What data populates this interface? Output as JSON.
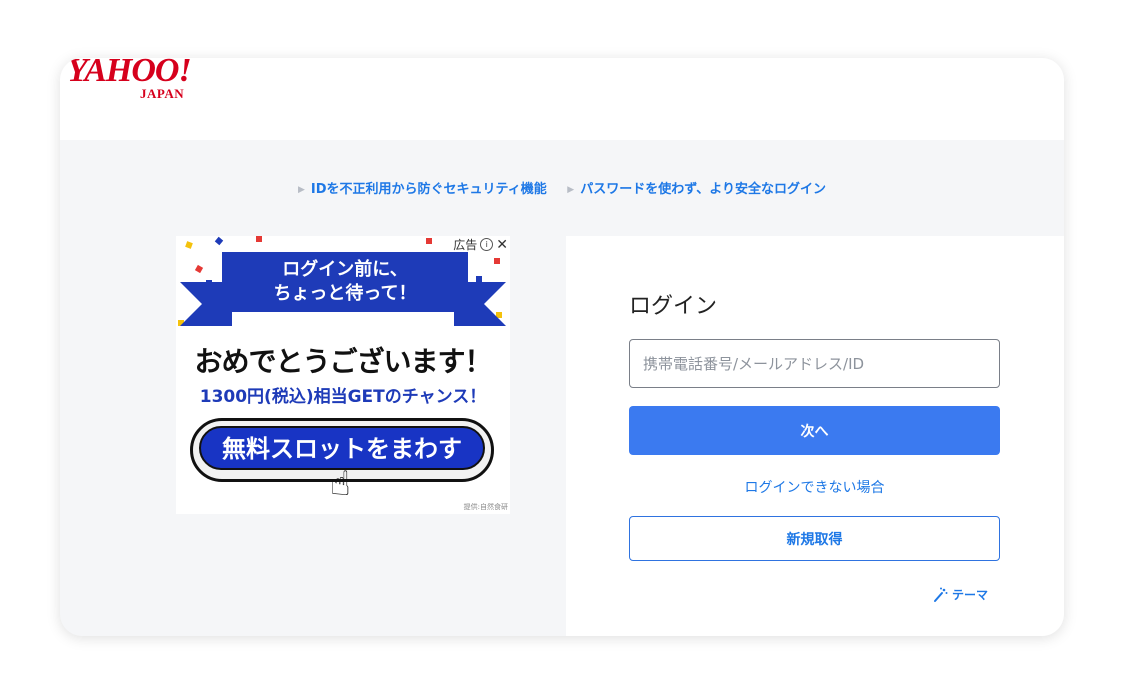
{
  "header": {
    "logo_main": "YAHOO!",
    "logo_sub": "JAPAN"
  },
  "features": {
    "items": [
      "IDを不正利用から防ぐセキュリティ機能",
      "パスワードを使わず、より安全なログイン"
    ]
  },
  "ad": {
    "label": "広告",
    "banner_text": "ログイン前に、\nちょっと待って！",
    "headline": "おめでとうございます！",
    "subline": "1300円(税込)相当GETのチャンス！",
    "cta": "無料スロットをまわす",
    "credit": "提供:自然食研"
  },
  "login": {
    "title": "ログイン",
    "input_placeholder": "携帯電話番号/メールアドレス/ID",
    "input_value": "",
    "next_label": "次へ",
    "trouble_link": "ログインできない場合",
    "signup_label": "新規取得",
    "theme_label": "テーマ"
  },
  "colors": {
    "brand_red": "#d6001c",
    "link_blue": "#1e78e6",
    "primary_button": "#3b7af0",
    "ad_blue": "#1e3bb8"
  }
}
